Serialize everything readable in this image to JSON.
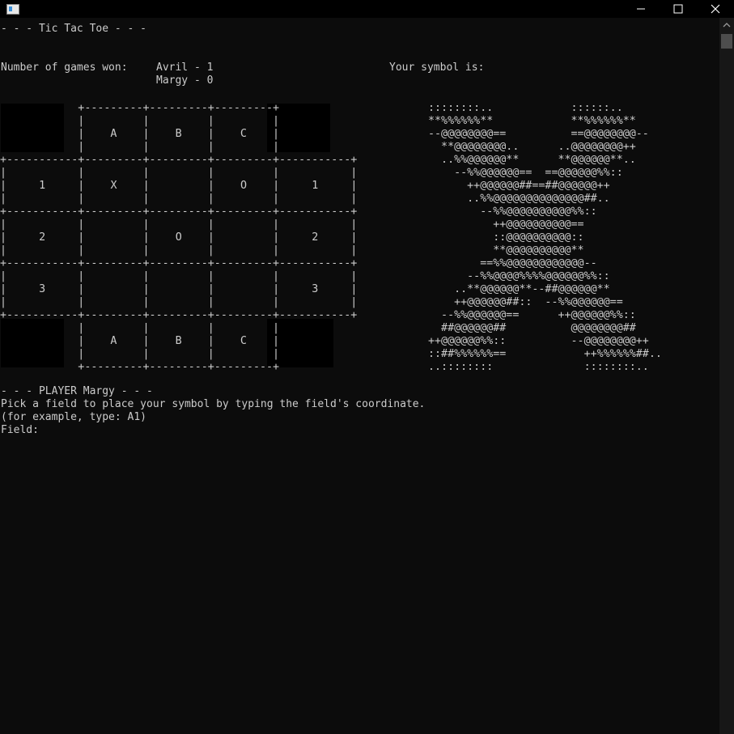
{
  "window": {
    "minimize_label": "Minimize",
    "maximize_label": "Maximize",
    "close_label": "Close"
  },
  "console": {
    "title_line": "- - - Tic Tac Toe - - -",
    "games_won_label": "Number of games won:",
    "player1_score": "Avril - 1",
    "player2_score": "Margy - 0",
    "symbol_label": "Your symbol is:",
    "player_header": "- - - PLAYER Margy - - -",
    "instruction_line": "Pick a field to place your symbol by typing the field's coordinate.",
    "example_line": "(for example, type: A1)",
    "prompt_label": "Field:"
  },
  "board": {
    "columns": [
      "A",
      "B",
      "C"
    ],
    "rows": [
      "1",
      "2",
      "3"
    ],
    "cells": {
      "A1": "X",
      "B1": "",
      "C1": "O",
      "A2": "",
      "B2": "O",
      "C2": "",
      "A3": "",
      "B3": "",
      "C3": ""
    }
  },
  "symbol_art": [
    "::::::::..            ::::::..",
    "**%%%%%%**            **%%%%%%**",
    "--@@@@@@@@==          ==@@@@@@@@--",
    "  **@@@@@@@@..      ..@@@@@@@@++",
    "  ..%%@@@@@@**      **@@@@@@**..",
    "    --%%@@@@@@==  ==@@@@@@%%::",
    "      ++@@@@@@##==##@@@@@@++",
    "      ..%%@@@@@@@@@@@@@@##..",
    "        --%%@@@@@@@@@@%%::",
    "          ++@@@@@@@@@@==",
    "          ::@@@@@@@@@@::",
    "          **@@@@@@@@@@**",
    "        ==%%@@@@@@@@@@@@--",
    "      --%%@@@@%%%%@@@@@@%%::",
    "    ..**@@@@@@**--##@@@@@@**",
    "    ++@@@@@@##::  --%%@@@@@@==",
    "  --%%@@@@@@==      ++@@@@@@%%::",
    "  ##@@@@@@##          @@@@@@@@##",
    "++@@@@@@%%::          --@@@@@@@@++",
    "::##%%%%%%==            ++%%%%%%##..",
    "..::::::::              ::::::::.."
  ]
}
